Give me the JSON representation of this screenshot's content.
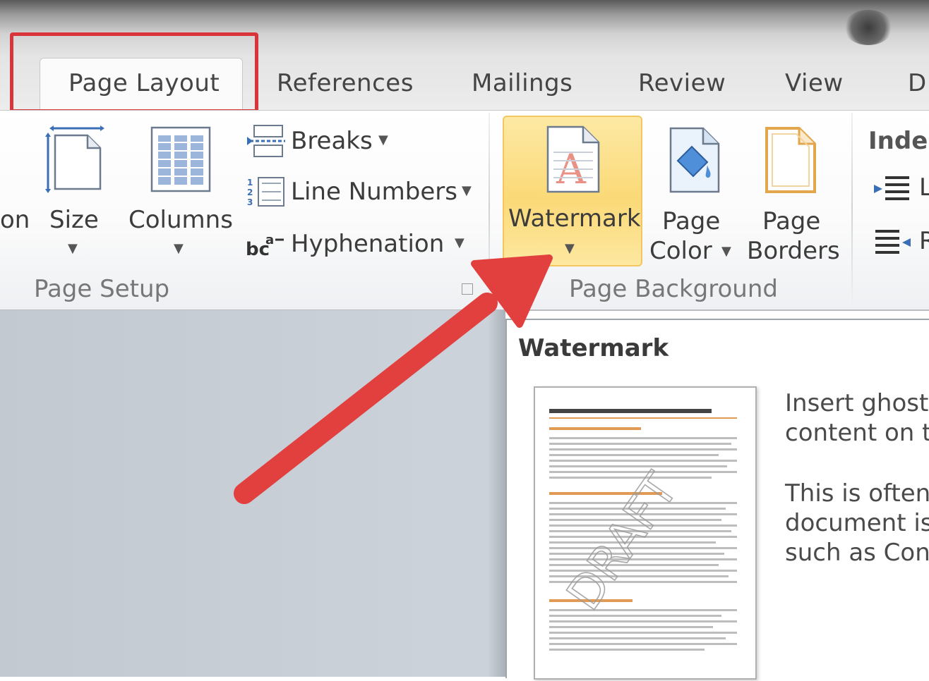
{
  "tabs": [
    {
      "label": "Page Layout",
      "active": true
    },
    {
      "label": "References"
    },
    {
      "label": "Mailings"
    },
    {
      "label": "Review"
    },
    {
      "label": "View"
    },
    {
      "label": "D"
    }
  ],
  "ribbon": {
    "page_setup": {
      "partial_label": "on",
      "size_label": "Size",
      "columns_label": "Columns",
      "breaks_label": "Breaks",
      "line_numbers_label": "Line Numbers",
      "hyphenation_label": "Hyphenation",
      "group_label": "Page Setup"
    },
    "page_background": {
      "watermark_label": "Watermark",
      "page_color_label": [
        "Page",
        "Color"
      ],
      "page_borders_label": [
        "Page",
        "Borders"
      ],
      "group_label": "Page Background"
    },
    "paragraph": {
      "indent_label": "Inder",
      "left_partial": "L",
      "right_partial": "R"
    }
  },
  "tooltip": {
    "title": "Watermark",
    "lines": [
      "Insert ghost",
      "content on t",
      "",
      "This is often",
      "document is",
      "such as Con"
    ],
    "thumbnail_watermark": "DRAFT"
  },
  "colors": {
    "highlight_box": "#d9343a",
    "arrow": "#e2403f",
    "watermark_hover": "#fbd977"
  }
}
